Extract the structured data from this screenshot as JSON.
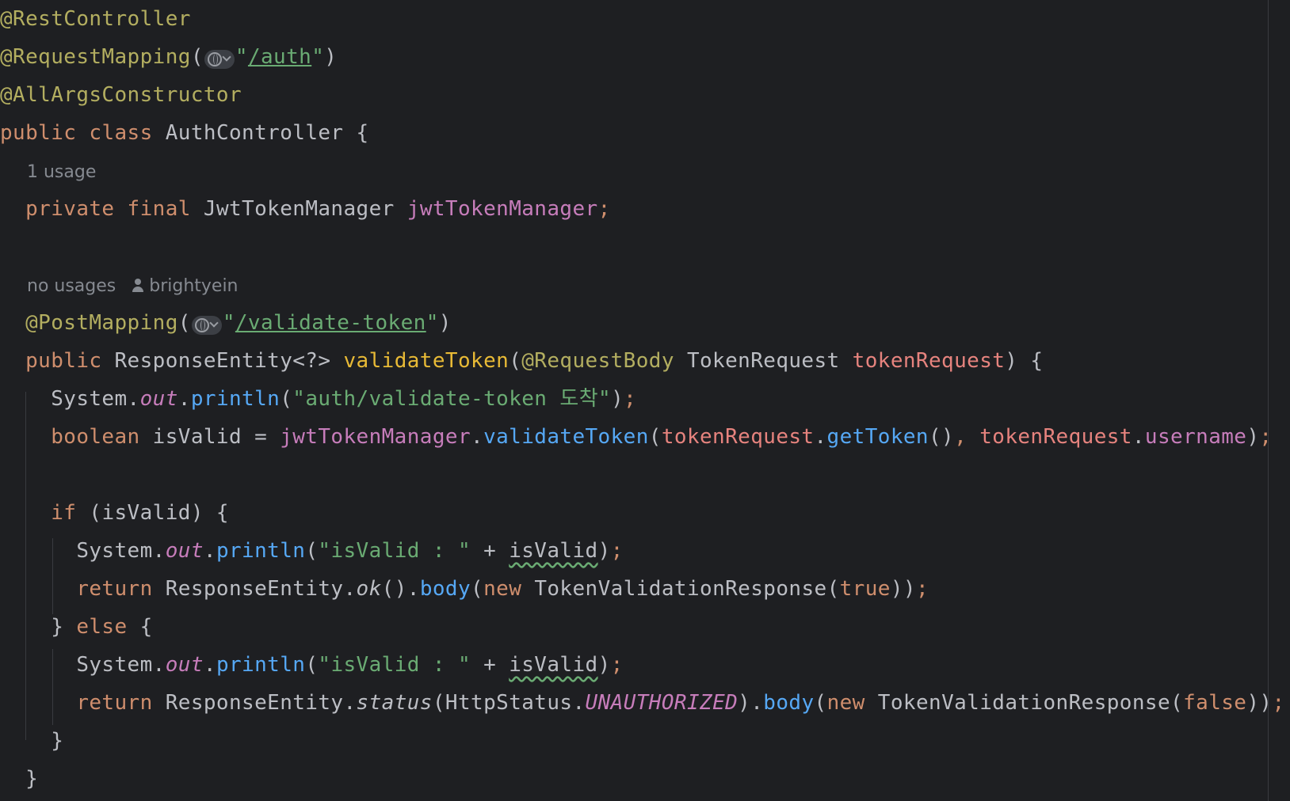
{
  "editor": {
    "annotations": {
      "rest_controller": "@RestController",
      "request_mapping": "@RequestMapping",
      "all_args": "@AllArgsConstructor",
      "post_mapping": "@PostMapping",
      "request_body": "@RequestBody"
    },
    "strings": {
      "auth_path": "/auth",
      "validate_path": "/validate-token",
      "arrival_msg": "\"auth/validate-token 도착\"",
      "is_valid_msg": "\"isValid : \""
    },
    "keywords": {
      "public": "public",
      "class": "class",
      "private": "private",
      "final": "final",
      "boolean": "boolean",
      "if": "if",
      "else": "else",
      "return": "return",
      "new": "new",
      "true": "true",
      "false": "false"
    },
    "identifiers": {
      "auth_controller": "AuthController",
      "jwt_token_manager_type": "JwtTokenManager",
      "jwt_token_manager_field": "jwtTokenManager",
      "response_entity": "ResponseEntity",
      "response_entity_generic": "ResponseEntity<?>",
      "validate_token": "validateToken",
      "token_request_type": "TokenRequest",
      "token_request_param": "tokenRequest",
      "system": "System",
      "out": "out",
      "println": "println",
      "is_valid": "isValid",
      "get_token": "getToken",
      "username": "username",
      "ok": "ok",
      "body": "body",
      "status": "status",
      "http_status": "HttpStatus",
      "unauthorized": "UNAUTHORIZED",
      "token_validation_response": "TokenValidationResponse"
    },
    "hints": {
      "usage_field": "1 usage",
      "usage_method": "no usages",
      "author": "brightyein"
    },
    "icons": {
      "endpoint": "globe-icon",
      "dropdown": "chevron-down-icon",
      "author": "person-icon"
    },
    "colors": {
      "background": "#1e1f22",
      "annotation": "#b3ae60",
      "keyword": "#cf8e6d",
      "string": "#6aab73",
      "field": "#c77dbb",
      "method_call": "#56a8f5",
      "declaration": "#e8ba36",
      "parameter": "#e6837e",
      "hint": "#868a91"
    }
  }
}
